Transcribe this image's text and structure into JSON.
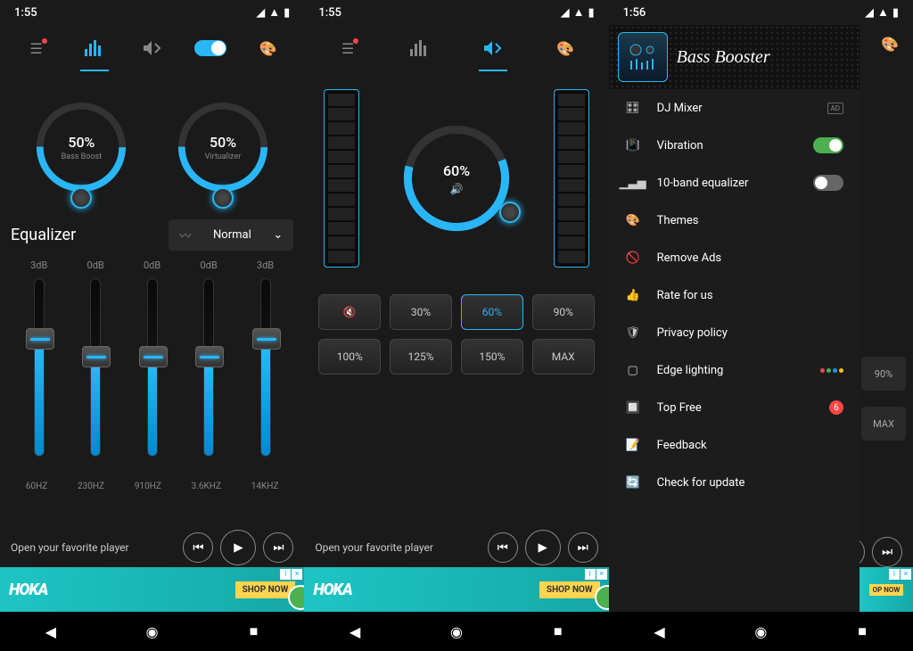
{
  "screen1": {
    "time": "1:55",
    "bass_boost": {
      "percent": "50%",
      "label": "Bass Boost"
    },
    "virtualizer": {
      "percent": "50%",
      "label": "Virtualizer"
    },
    "eq_title": "Equalizer",
    "preset": "Normal",
    "db": [
      "3dB",
      "0dB",
      "0dB",
      "0dB",
      "3dB"
    ],
    "hz": [
      "60HZ",
      "230HZ",
      "910HZ",
      "3.6KHZ",
      "14KHZ"
    ],
    "player_text": "Open your favorite player",
    "ad": {
      "logo": "HOKA",
      "cta": "SHOP NOW"
    }
  },
  "screen2": {
    "time": "1:55",
    "volume": "60%",
    "presets": [
      "30%",
      "60%",
      "90%",
      "100%",
      "125%",
      "150%",
      "MAX"
    ],
    "player_text": "Open your favorite player",
    "ad": {
      "logo": "HOKA",
      "cta": "SHOP NOW"
    }
  },
  "screen3": {
    "time": "1:56",
    "app_title": "Bass Booster",
    "items": [
      {
        "label": "DJ Mixer",
        "ad": "AD"
      },
      {
        "label": "Vibration"
      },
      {
        "label": "10-band equalizer"
      },
      {
        "label": "Themes"
      },
      {
        "label": "Remove Ads"
      },
      {
        "label": "Rate for us"
      },
      {
        "label": "Privacy policy"
      },
      {
        "label": "Edge lighting"
      },
      {
        "label": "Top Free",
        "badge": "6"
      },
      {
        "label": "Feedback"
      },
      {
        "label": "Check for update"
      }
    ],
    "backdrop": {
      "p1": "90%",
      "p2": "MAX"
    }
  }
}
